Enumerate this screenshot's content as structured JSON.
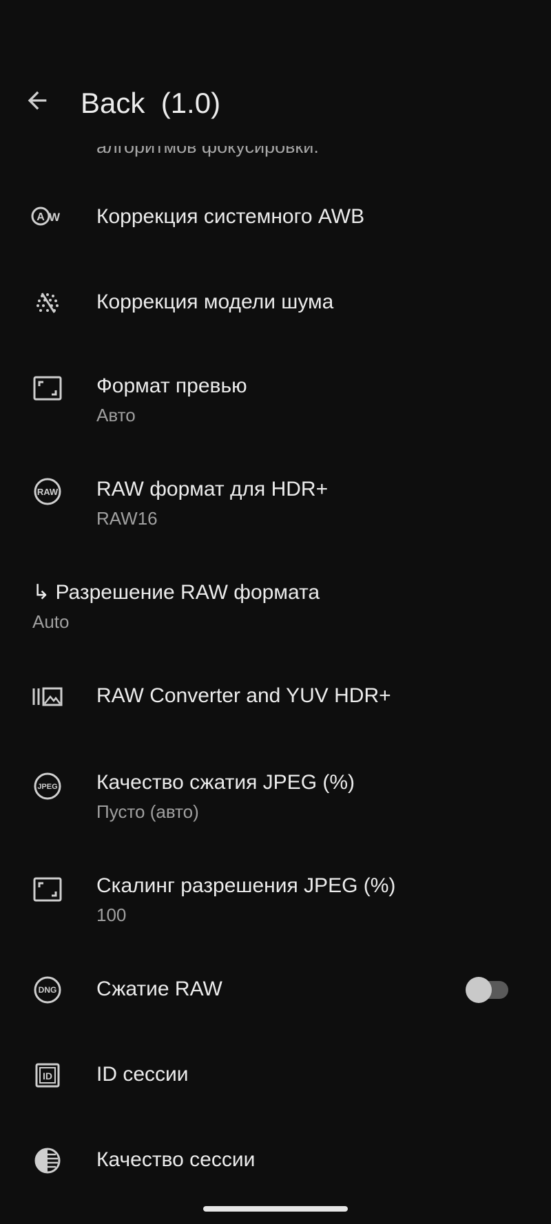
{
  "header": {
    "title": "Back  (1.0)"
  },
  "clipped_text": "алгоритмов фокусировки.",
  "settings": [
    {
      "label": "Коррекция системного AWB",
      "icon": "awb-icon",
      "icon_text": "AW"
    },
    {
      "label": "Коррекция модели шума",
      "icon": "noise-grain-icon"
    },
    {
      "label": "Формат превью",
      "value": "Авто",
      "icon": "aspect-ratio-icon"
    },
    {
      "label": "RAW формат для HDR+",
      "value": "RAW16",
      "icon": "raw-icon",
      "icon_text": "RAW"
    },
    {
      "label": "↳ Разрешение RAW формата",
      "value": "Auto"
    },
    {
      "label": "RAW Converter and YUV HDR+",
      "icon": "raw-converter-icon"
    },
    {
      "label": "Качество сжатия JPEG (%)",
      "value": "Пусто (авто)",
      "icon": "jpeg-icon",
      "icon_text": "JPEG"
    },
    {
      "label": "Скалинг разрешения JPEG (%)",
      "value": "100",
      "icon": "aspect-ratio-icon"
    },
    {
      "label": "Сжатие RAW",
      "icon": "dng-icon",
      "icon_text": "DNG",
      "toggle": false
    },
    {
      "label": "ID сессии",
      "icon": "id-icon",
      "icon_text": "ID"
    },
    {
      "label": "Качество сессии",
      "icon": "contrast-icon"
    }
  ],
  "colors": {
    "background": "#0e0e0e",
    "primary_text": "#ececec",
    "secondary_text": "#a0a0a0",
    "switch_off_track": "#5a5a5a",
    "switch_off_thumb": "#c9c9c9"
  }
}
